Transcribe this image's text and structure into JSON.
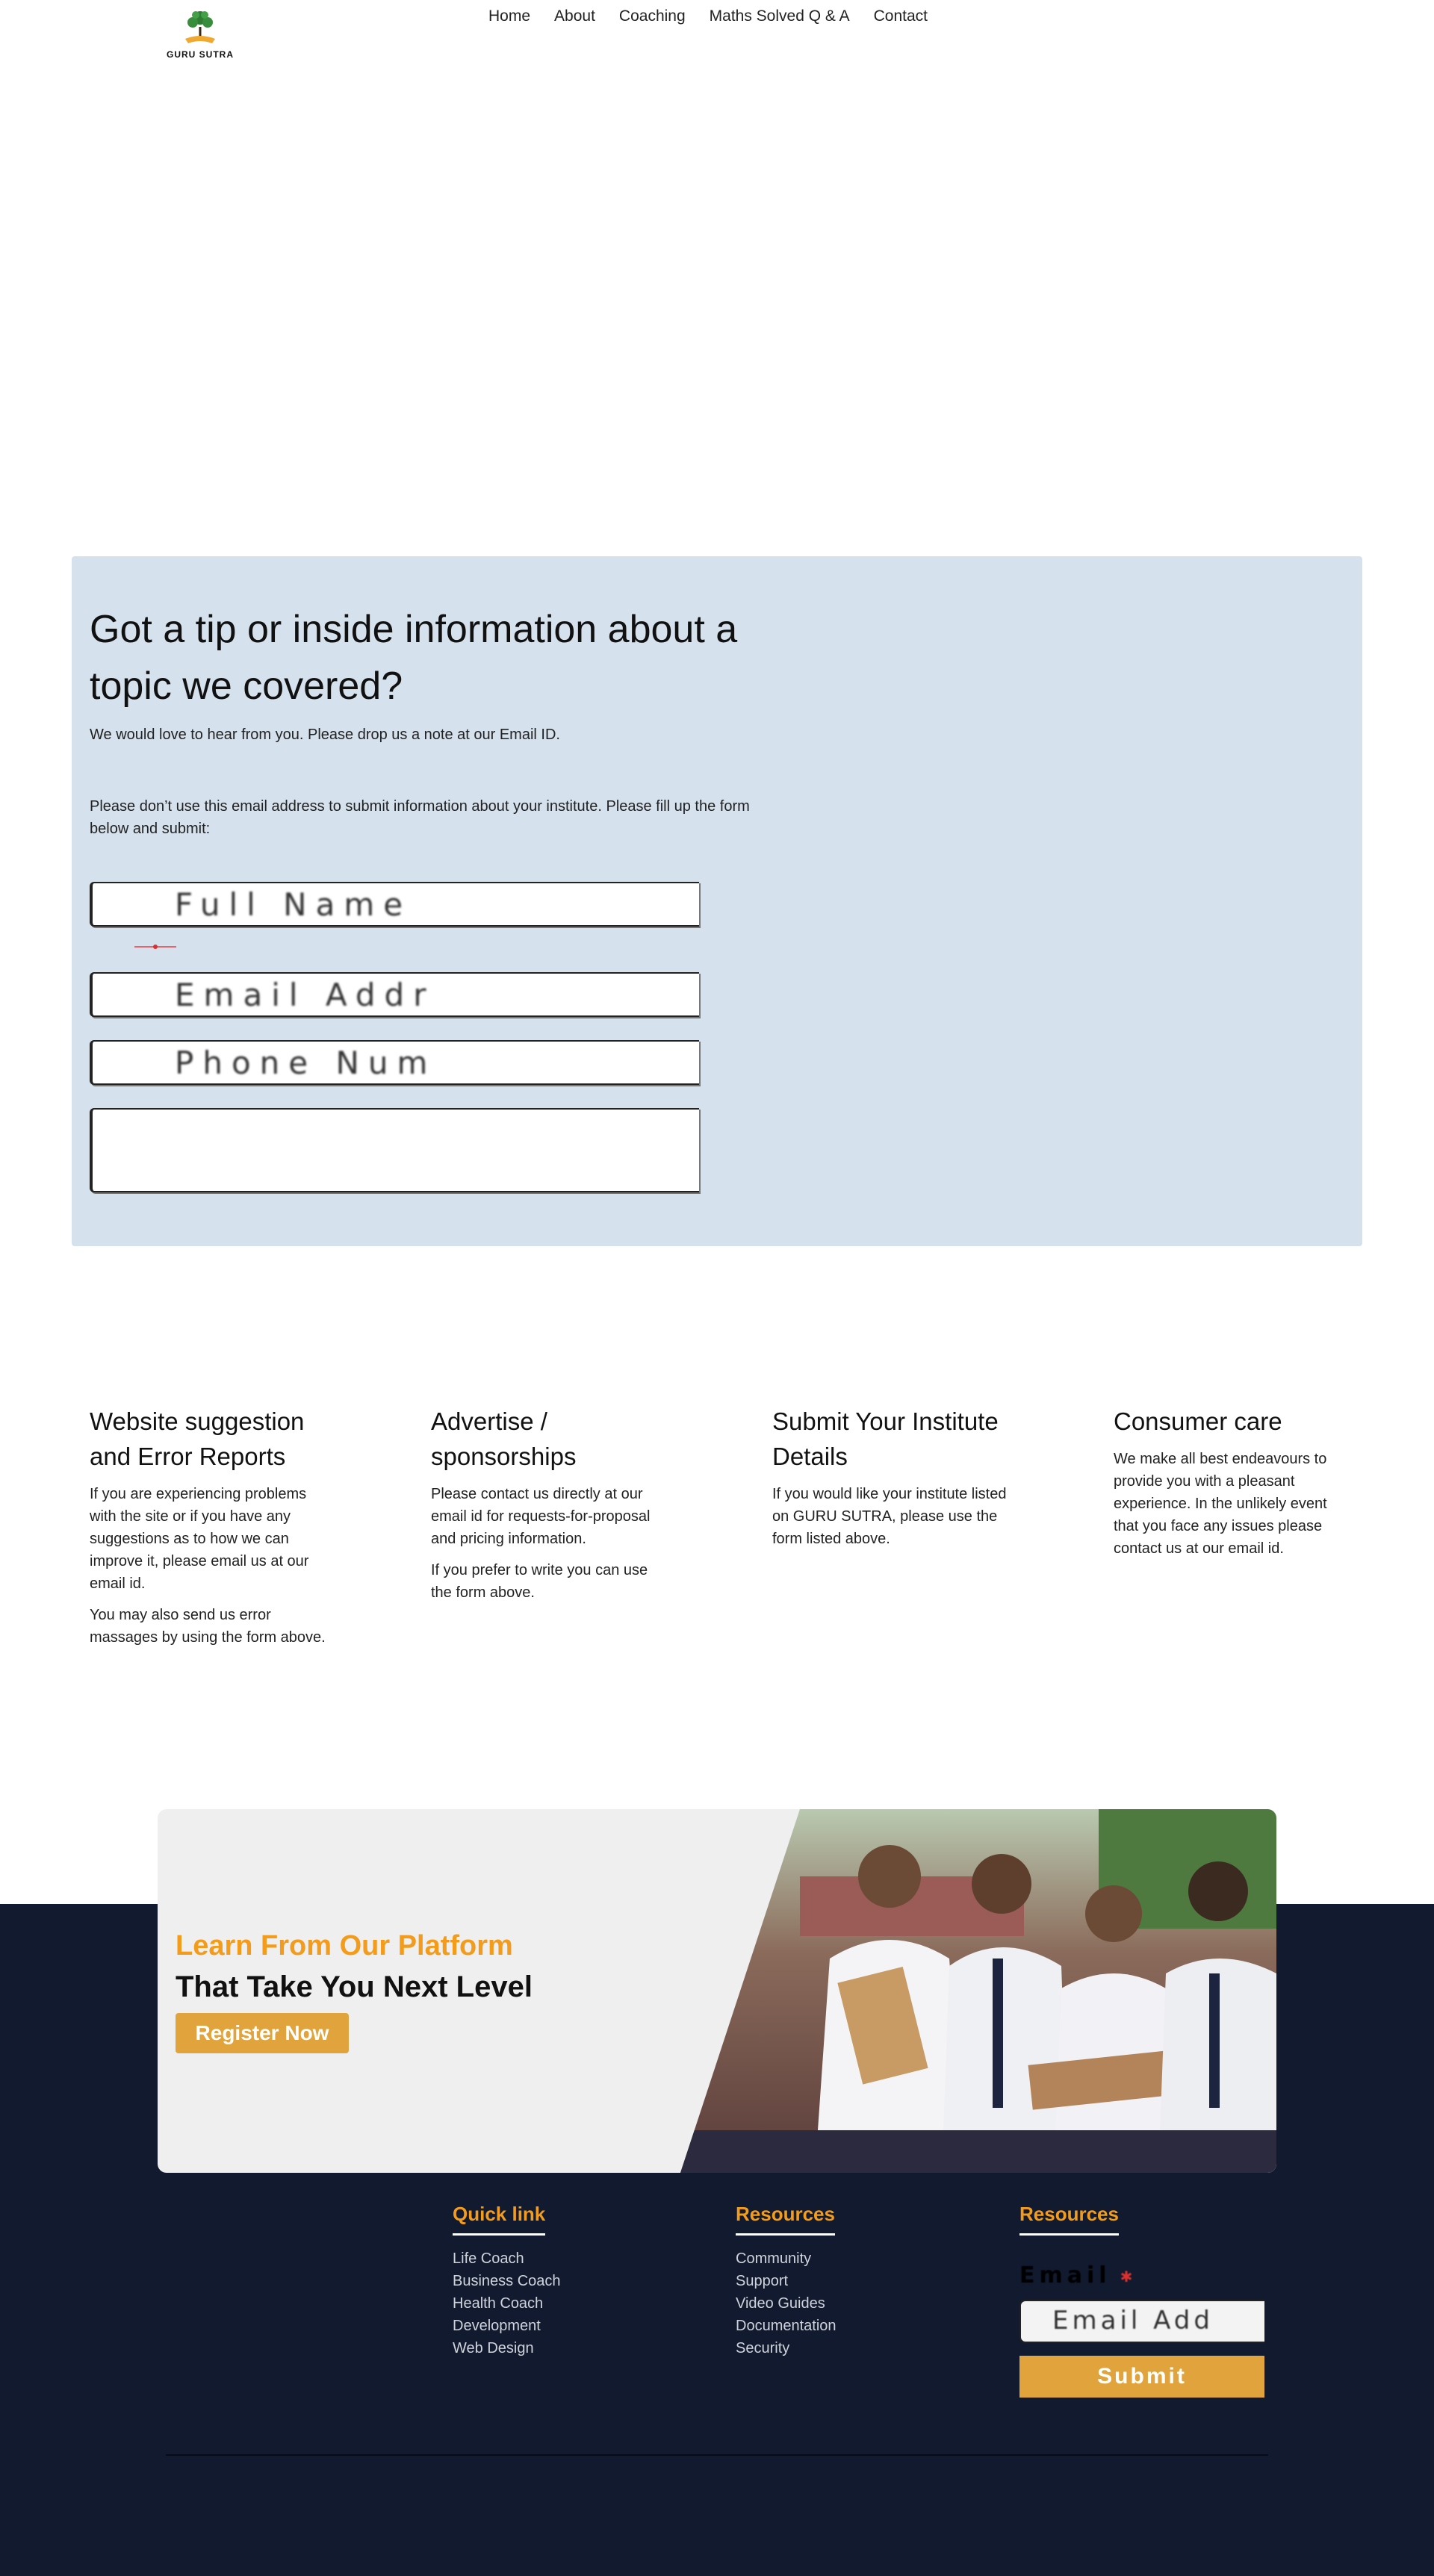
{
  "brand": {
    "name": "GURU SUTRA"
  },
  "nav": {
    "items": [
      "Home",
      "About",
      "Coaching",
      "Maths Solved Q & A",
      "Contact"
    ]
  },
  "contact": {
    "title": "Got a tip or inside information about a topic we covered?",
    "intro": "We would love to hear from you. Please drop us a note at our Email ID.",
    "note": "Please don’t use this email address to submit information about your institute. Please fill up the form below and submit:",
    "fields": {
      "name_placeholder": "Full Name",
      "email_placeholder": "Email Addr",
      "phone_placeholder": "Phone Num",
      "message_placeholder": ""
    }
  },
  "info": [
    {
      "title": "Website suggestion and Error Reports",
      "paragraphs": [
        "If you are experiencing problems with the site or if you have any suggestions as to how we can improve it, please email us at our email id.",
        "You may also send us error massages by using the form above."
      ]
    },
    {
      "title": "Advertise / sponsorships",
      "paragraphs": [
        "Please contact us directly at our email id for requests-for-proposal and pricing information.",
        "If you prefer to write you can use the form above."
      ]
    },
    {
      "title": "Submit Your Institute Details",
      "paragraphs": [
        "If you would like your institute listed on GURU SUTRA, please use the form listed above."
      ]
    },
    {
      "title": "Consumer care",
      "paragraphs": [
        "We make all best endeavours to provide you with a pleasant experience. In the unlikely event that you face any issues please contact us at our email id."
      ]
    }
  ],
  "promo": {
    "headline_orange": "Learn From Our Platform",
    "headline_black": "That Take You Next Level",
    "button": "Register Now"
  },
  "footer": {
    "quick_link": {
      "title": "Quick link",
      "items": [
        "Life Coach",
        "Business Coach",
        "Health Coach",
        "Development",
        "Web Design"
      ]
    },
    "resources": {
      "title": "Resources",
      "items": [
        "Community",
        "Support",
        "Video Guides",
        "Documentation",
        "Security"
      ]
    },
    "newsletter": {
      "title": "Resources",
      "email_label": "Email",
      "email_placeholder": "Email Add",
      "submit": "Submit"
    }
  },
  "colors": {
    "accent_orange": "#f39c1b",
    "button_gold": "#e1a43c",
    "footer_navy": "#111a2f",
    "card_blue": "#d5e1ec"
  }
}
